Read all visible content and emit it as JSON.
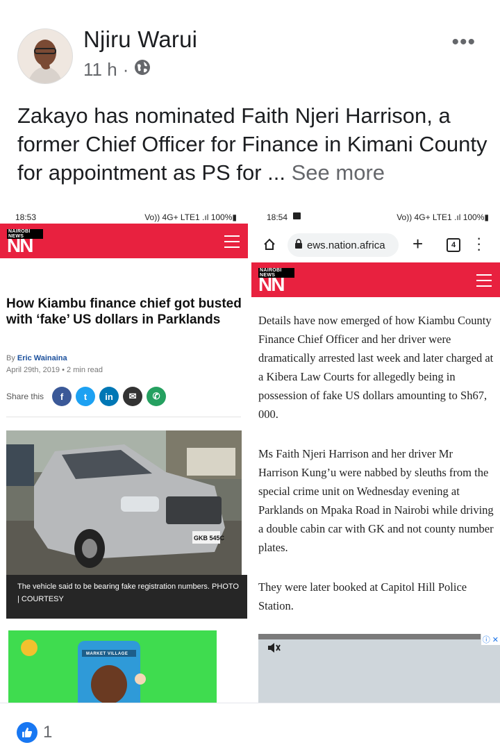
{
  "post": {
    "author": "Njiru Warui",
    "time": "11 h",
    "separator": "·",
    "text": "Zakayo has nominated Faith Njeri Harrison, a former Chief Officer for Finance in Kimani County for appointment as PS for ...",
    "see_more": "See more",
    "more_icon": "•••"
  },
  "left_screenshot": {
    "status_time": "18:53",
    "status_icons": "Vo)) 4G+ LTE1 .ıl 100%▮",
    "logo_small": "NAIROBI NEWS",
    "logo_big": "NN",
    "headline": "How Kiambu finance chief got busted with ‘fake’ US dollars in Parklands",
    "by_label": "By",
    "author": "Eric Wainaina",
    "date": "April 29th, 2019",
    "dot": "•",
    "read_time": "2 min read",
    "share_label": "Share this",
    "share_icons": [
      "f",
      "t",
      "in",
      "✉",
      "✆"
    ],
    "caption": "The vehicle said to be bearing fake registration numbers. PHOTO | COURTESY",
    "plate": "GKB 545C",
    "ad_text": "MARKET VILLAGE"
  },
  "right_screenshot": {
    "status_time": "18:54",
    "status_icons": "Vo)) 4G+ LTE1 .ıl 100%▮",
    "url": "ews.nation.africa",
    "tab_count": "4",
    "logo_small": "NAIROBI NEWS",
    "logo_big": "NN",
    "paragraphs": [
      "Details have now emerged of how Kiambu County Finance Chief Officer and her driver were dramatically arrested last week and later charged at a Kibera Law Courts for allegedly being in possession of fake US dollars amounting to Sh67, 000.",
      "Ms Faith Njeri Harrison and her driver Mr Harrison Kung’u were nabbed by sleuths from the special crime unit on Wednesday evening at Parklands on Mpaka Road in Nairobi while driving a double cabin car with GK and not county number plates.",
      "They were later booked at Capitol Hill Police Station."
    ],
    "ad_info": "ⓘ ✕"
  },
  "reactions": {
    "count": "1"
  },
  "colors": {
    "nn_red": "#e8213f",
    "fb_blue": "#1877f2",
    "facebook": "#3b5998",
    "twitter": "#1da1f2",
    "linkedin": "#0077b5",
    "email": "#333333",
    "whatsapp": "#25a060"
  }
}
